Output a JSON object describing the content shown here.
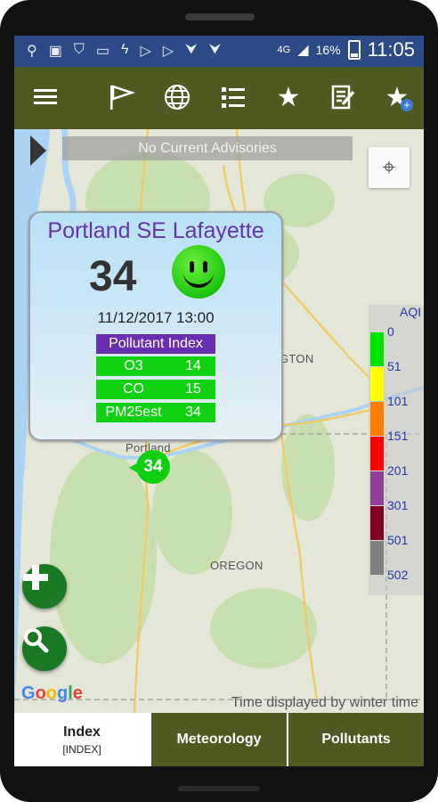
{
  "status_bar": {
    "time": "11:05",
    "battery_percent": "16%",
    "network": "4G"
  },
  "toolbar": {
    "icons": [
      "menu-icon",
      "flag-icon",
      "globe-icon",
      "list-icon",
      "star-icon",
      "edit-note-icon",
      "add-favorite-icon"
    ]
  },
  "map": {
    "advisory": "No Current Advisories",
    "labels": {
      "portland": "Portland",
      "washington_fragment": "GTON",
      "oregon": "OREGON"
    },
    "attribution": "Google",
    "time_note": "Time displayed by winter time"
  },
  "popup": {
    "station": "Portland SE Lafayette",
    "aqi": "34",
    "datetime": "11/12/2017 13:00",
    "table_header": "Pollutant Index",
    "pollutants": [
      {
        "name": "O3",
        "value": "14"
      },
      {
        "name": "CO",
        "value": "15"
      },
      {
        "name": "PM25est",
        "value": "34"
      }
    ]
  },
  "marker": {
    "value": "34"
  },
  "legend": {
    "title": "AQI",
    "levels": [
      {
        "label": "0",
        "color": "#00e400"
      },
      {
        "label": "51",
        "color": "#ffff00"
      },
      {
        "label": "101",
        "color": "#ff7e00"
      },
      {
        "label": "151",
        "color": "#ff0000"
      },
      {
        "label": "201",
        "color": "#8f3f97"
      },
      {
        "label": "301",
        "color": "#7e0023"
      },
      {
        "label": "501",
        "color": "#808080"
      },
      {
        "label": "502",
        "color": ""
      }
    ]
  },
  "tabs": [
    {
      "label": "Index",
      "sub": "[INDEX]",
      "active": true
    },
    {
      "label": "Meteorology",
      "sub": "",
      "active": false
    },
    {
      "label": "Pollutants",
      "sub": "",
      "active": false
    }
  ],
  "colors": {
    "toolbar": "#4e5a22",
    "status_bar": "#2c4a85",
    "good_green": "#12d012",
    "header_purple": "#6a2fb0"
  }
}
